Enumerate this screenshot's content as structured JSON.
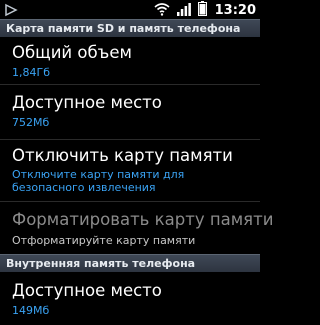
{
  "status_bar": {
    "time": "13:20",
    "icons": [
      "screenshot-icon",
      "wifi-icon",
      "signal-icon",
      "battery-icon"
    ]
  },
  "sections": [
    {
      "header": "Карта памяти SD и память телефона"
    },
    {
      "header": "Внутренняя память телефона"
    }
  ],
  "items": {
    "total": {
      "title": "Общий объем",
      "value": "1,84Гб"
    },
    "available": {
      "title": "Доступное место",
      "value": "752Мб"
    },
    "unmount": {
      "title": "Отключить карту памяти",
      "summary_line1": "Отключите карту памяти для",
      "summary_line2": "безопасного извлечения"
    },
    "format": {
      "title": "Форматировать карту памяти",
      "summary": "Отформатируйте карту памяти"
    },
    "internal_available": {
      "title": "Доступное место",
      "value": "149Мб"
    }
  },
  "colors": {
    "accent": "#3aa3f4",
    "header_bg": "#333b47",
    "background": "#000000"
  }
}
